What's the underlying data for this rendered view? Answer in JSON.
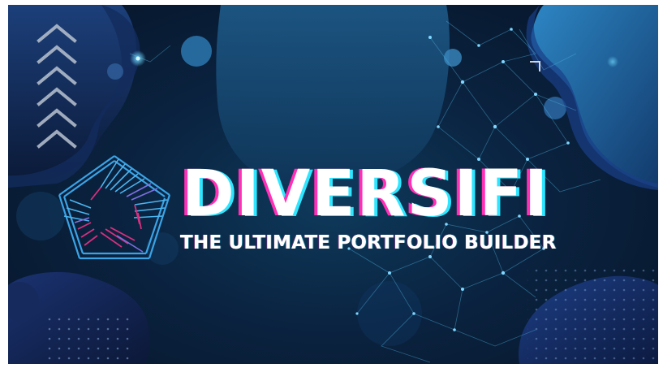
{
  "brand": {
    "name": "DIVERSIFI",
    "tagline": "THE ULTIMATE PORTFOLIO BUILDER"
  },
  "colors": {
    "background": "#0a2340",
    "blob_blue": "#1d5a8c",
    "blob_navy": "#162a5a",
    "accent_pink": "#ff2fb6",
    "accent_cyan": "#2ee6ff",
    "logo_blue": "#3aa3e6",
    "logo_magenta": "#d6307f"
  },
  "icons": [
    "chevron-up-icon",
    "pentagon-logo-icon"
  ]
}
